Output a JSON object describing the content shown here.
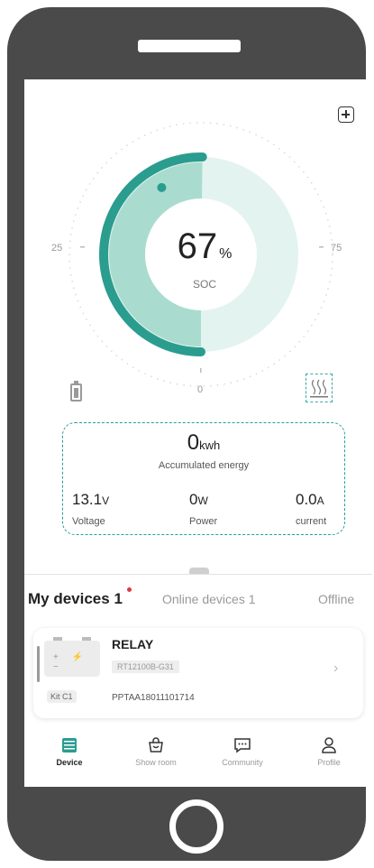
{
  "gauge": {
    "soc_value": "67",
    "soc_unit": "%",
    "soc_label": "SOC",
    "soc_fraction": 0.67,
    "tick_left": "25",
    "tick_right": "75",
    "tick_bottom": "0"
  },
  "energy": {
    "value": "0",
    "unit": "kwh",
    "label": "Accumulated energy"
  },
  "metrics": {
    "voltage": {
      "value": "13.1",
      "unit": "V",
      "label": "Voltage"
    },
    "power": {
      "value": "0",
      "unit": "W",
      "label": "Power"
    },
    "current": {
      "value": "0.0",
      "unit": "A",
      "label": "current"
    }
  },
  "tabs": {
    "my_devices": "My devices 1",
    "online_devices": "Online devices 1",
    "offline": "Offline"
  },
  "device": {
    "name": "RELAY",
    "model": "RT12100B-G31",
    "serial": "PPTAA18011101714",
    "kit": "Kit C1",
    "battery_symbols": "+ ⚡ −"
  },
  "nav": {
    "device": "Device",
    "showroom": "Show room",
    "community": "Community",
    "profile": "Profile"
  },
  "colors": {
    "accent": "#2a9d8f",
    "accent_light": "#a9dccf",
    "accent_pale": "#e3f3ef",
    "badge_red": "#e0393e",
    "phone_body": "#4a4a4a"
  },
  "icons": {
    "add": "plus-square-icon",
    "battery": "battery-icon",
    "heater": "heater-icon",
    "chevron": "chevron-right-icon",
    "device_nav": "device-grid-icon",
    "showroom_nav": "shopping-bag-icon",
    "community_nav": "chat-bubble-icon",
    "profile_nav": "user-icon"
  }
}
